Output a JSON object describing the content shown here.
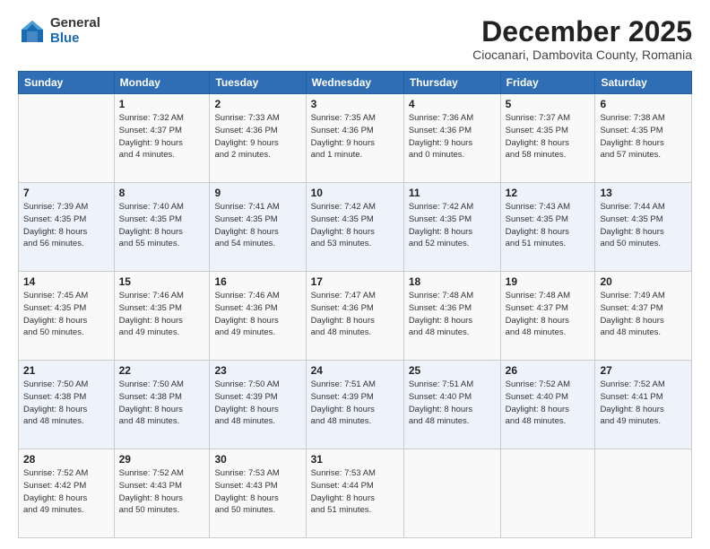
{
  "logo": {
    "general": "General",
    "blue": "Blue"
  },
  "header": {
    "month": "December 2025",
    "location": "Ciocanari, Dambovita County, Romania"
  },
  "days_of_week": [
    "Sunday",
    "Monday",
    "Tuesday",
    "Wednesday",
    "Thursday",
    "Friday",
    "Saturday"
  ],
  "weeks": [
    [
      {
        "day": "",
        "info": ""
      },
      {
        "day": "1",
        "info": "Sunrise: 7:32 AM\nSunset: 4:37 PM\nDaylight: 9 hours\nand 4 minutes."
      },
      {
        "day": "2",
        "info": "Sunrise: 7:33 AM\nSunset: 4:36 PM\nDaylight: 9 hours\nand 2 minutes."
      },
      {
        "day": "3",
        "info": "Sunrise: 7:35 AM\nSunset: 4:36 PM\nDaylight: 9 hours\nand 1 minute."
      },
      {
        "day": "4",
        "info": "Sunrise: 7:36 AM\nSunset: 4:36 PM\nDaylight: 9 hours\nand 0 minutes."
      },
      {
        "day": "5",
        "info": "Sunrise: 7:37 AM\nSunset: 4:35 PM\nDaylight: 8 hours\nand 58 minutes."
      },
      {
        "day": "6",
        "info": "Sunrise: 7:38 AM\nSunset: 4:35 PM\nDaylight: 8 hours\nand 57 minutes."
      }
    ],
    [
      {
        "day": "7",
        "info": "Sunrise: 7:39 AM\nSunset: 4:35 PM\nDaylight: 8 hours\nand 56 minutes."
      },
      {
        "day": "8",
        "info": "Sunrise: 7:40 AM\nSunset: 4:35 PM\nDaylight: 8 hours\nand 55 minutes."
      },
      {
        "day": "9",
        "info": "Sunrise: 7:41 AM\nSunset: 4:35 PM\nDaylight: 8 hours\nand 54 minutes."
      },
      {
        "day": "10",
        "info": "Sunrise: 7:42 AM\nSunset: 4:35 PM\nDaylight: 8 hours\nand 53 minutes."
      },
      {
        "day": "11",
        "info": "Sunrise: 7:42 AM\nSunset: 4:35 PM\nDaylight: 8 hours\nand 52 minutes."
      },
      {
        "day": "12",
        "info": "Sunrise: 7:43 AM\nSunset: 4:35 PM\nDaylight: 8 hours\nand 51 minutes."
      },
      {
        "day": "13",
        "info": "Sunrise: 7:44 AM\nSunset: 4:35 PM\nDaylight: 8 hours\nand 50 minutes."
      }
    ],
    [
      {
        "day": "14",
        "info": "Sunrise: 7:45 AM\nSunset: 4:35 PM\nDaylight: 8 hours\nand 50 minutes."
      },
      {
        "day": "15",
        "info": "Sunrise: 7:46 AM\nSunset: 4:35 PM\nDaylight: 8 hours\nand 49 minutes."
      },
      {
        "day": "16",
        "info": "Sunrise: 7:46 AM\nSunset: 4:36 PM\nDaylight: 8 hours\nand 49 minutes."
      },
      {
        "day": "17",
        "info": "Sunrise: 7:47 AM\nSunset: 4:36 PM\nDaylight: 8 hours\nand 48 minutes."
      },
      {
        "day": "18",
        "info": "Sunrise: 7:48 AM\nSunset: 4:36 PM\nDaylight: 8 hours\nand 48 minutes."
      },
      {
        "day": "19",
        "info": "Sunrise: 7:48 AM\nSunset: 4:37 PM\nDaylight: 8 hours\nand 48 minutes."
      },
      {
        "day": "20",
        "info": "Sunrise: 7:49 AM\nSunset: 4:37 PM\nDaylight: 8 hours\nand 48 minutes."
      }
    ],
    [
      {
        "day": "21",
        "info": "Sunrise: 7:50 AM\nSunset: 4:38 PM\nDaylight: 8 hours\nand 48 minutes."
      },
      {
        "day": "22",
        "info": "Sunrise: 7:50 AM\nSunset: 4:38 PM\nDaylight: 8 hours\nand 48 minutes."
      },
      {
        "day": "23",
        "info": "Sunrise: 7:50 AM\nSunset: 4:39 PM\nDaylight: 8 hours\nand 48 minutes."
      },
      {
        "day": "24",
        "info": "Sunrise: 7:51 AM\nSunset: 4:39 PM\nDaylight: 8 hours\nand 48 minutes."
      },
      {
        "day": "25",
        "info": "Sunrise: 7:51 AM\nSunset: 4:40 PM\nDaylight: 8 hours\nand 48 minutes."
      },
      {
        "day": "26",
        "info": "Sunrise: 7:52 AM\nSunset: 4:40 PM\nDaylight: 8 hours\nand 48 minutes."
      },
      {
        "day": "27",
        "info": "Sunrise: 7:52 AM\nSunset: 4:41 PM\nDaylight: 8 hours\nand 49 minutes."
      }
    ],
    [
      {
        "day": "28",
        "info": "Sunrise: 7:52 AM\nSunset: 4:42 PM\nDaylight: 8 hours\nand 49 minutes."
      },
      {
        "day": "29",
        "info": "Sunrise: 7:52 AM\nSunset: 4:43 PM\nDaylight: 8 hours\nand 50 minutes."
      },
      {
        "day": "30",
        "info": "Sunrise: 7:53 AM\nSunset: 4:43 PM\nDaylight: 8 hours\nand 50 minutes."
      },
      {
        "day": "31",
        "info": "Sunrise: 7:53 AM\nSunset: 4:44 PM\nDaylight: 8 hours\nand 51 minutes."
      },
      {
        "day": "",
        "info": ""
      },
      {
        "day": "",
        "info": ""
      },
      {
        "day": "",
        "info": ""
      }
    ]
  ]
}
